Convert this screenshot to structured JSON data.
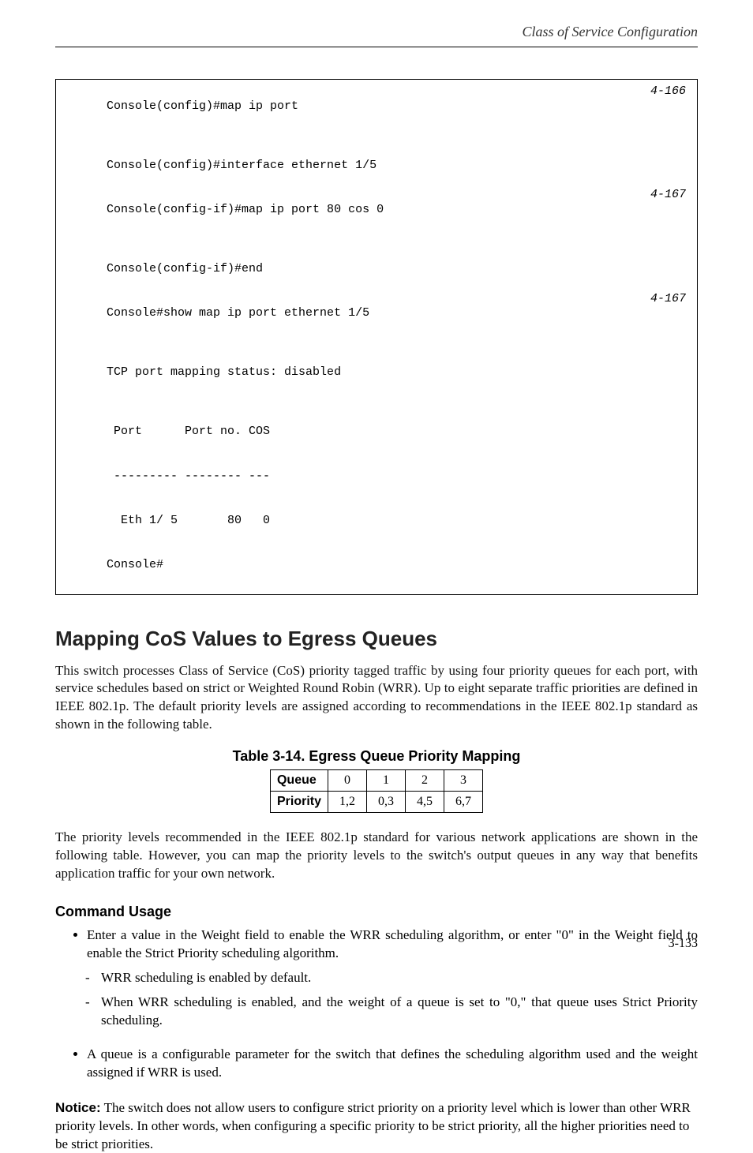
{
  "header": {
    "running_title": "Class of Service Configuration"
  },
  "console": {
    "lines": [
      {
        "text": "Console(config)#map ip port",
        "ref": "4-166"
      },
      {
        "text": "Console(config)#interface ethernet 1/5",
        "ref": ""
      },
      {
        "text": "Console(config-if)#map ip port 80 cos 0",
        "ref": "4-167"
      },
      {
        "text": "Console(config-if)#end",
        "ref": ""
      },
      {
        "text": "Console#show map ip port ethernet 1/5",
        "ref": "4-167"
      },
      {
        "text": "TCP port mapping status: disabled",
        "ref": ""
      },
      {
        "text": "",
        "ref": ""
      },
      {
        "text": " Port      Port no. COS",
        "ref": ""
      },
      {
        "text": " --------- -------- ---",
        "ref": ""
      },
      {
        "text": "  Eth 1/ 5       80   0",
        "ref": ""
      },
      {
        "text": "Console#",
        "ref": ""
      }
    ]
  },
  "section": {
    "heading": "Mapping CoS Values to Egress Queues",
    "para": "This switch processes Class of Service (CoS) priority tagged traffic by using four priority queues for each port, with service schedules based on strict or Weighted Round Robin (WRR). Up to eight separate traffic priorities are defined in IEEE 802.1p. The default priority levels are assigned according to recommendations in the IEEE 802.1p standard as shown in the following table."
  },
  "table": {
    "caption": "Table 3-14.  Egress Queue Priority Mapping",
    "rows": [
      {
        "label": "Queue",
        "cells": [
          "0",
          "1",
          "2",
          "3"
        ]
      },
      {
        "label": "Priority",
        "cells": [
          "1,2",
          "0,3",
          "4,5",
          "6,7"
        ]
      }
    ]
  },
  "after_table_para": "The priority levels recommended in the IEEE 802.1p standard for various network applications are shown in the following table. However, you can map the priority levels to the switch's output queues in any way that benefits application traffic for your own network.",
  "command_usage": {
    "heading": "Command Usage",
    "bullets": [
      {
        "text": "Enter a value in the Weight field to enable the WRR scheduling algorithm, or enter \"0\" in the Weight field to enable the Strict Priority scheduling algorithm.",
        "subs": [
          "WRR scheduling is enabled by default.",
          "When WRR scheduling is enabled, and the weight of a queue is set to \"0,\" that queue uses Strict Priority scheduling."
        ]
      },
      {
        "text": "A queue is a configurable parameter for the switch that defines the scheduling algorithm used and the weight assigned if WRR is used."
      }
    ]
  },
  "notice": {
    "label": "Notice:",
    "text": " The switch does not allow users to configure strict priority on a priority level which is lower than other WRR priority levels. In other words, when configuring a specific priority to be strict priority, all the higher priorities need to be strict priorities."
  },
  "footer": {
    "page_number": "3-133"
  }
}
